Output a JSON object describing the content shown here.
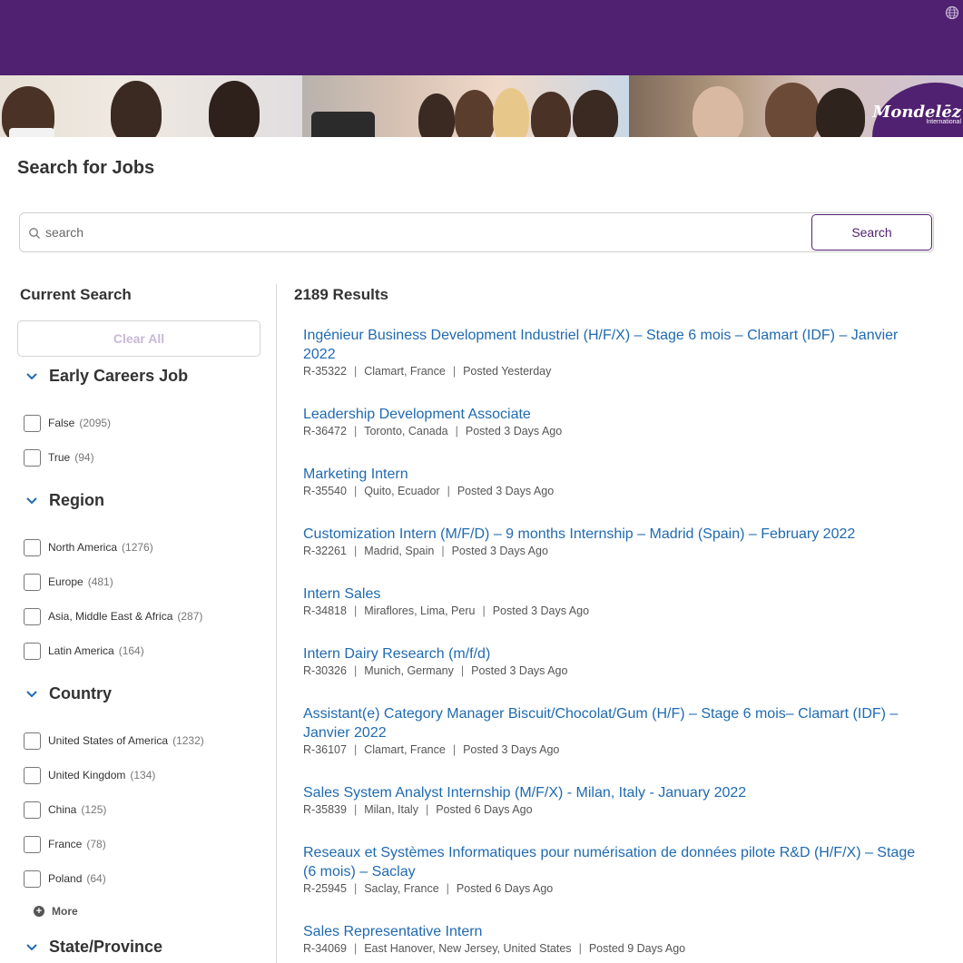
{
  "banner": {
    "brand_name": "Mondelēz",
    "brand_sub": "International"
  },
  "page": {
    "title": "Search for Jobs"
  },
  "search": {
    "placeholder": "search",
    "button_label": "Search"
  },
  "sidebar": {
    "current_search_label": "Current Search",
    "clear_all_label": "Clear All",
    "facets": [
      {
        "title": "Early Careers Job",
        "options": [
          {
            "label": "False",
            "count": "(2095)"
          },
          {
            "label": "True",
            "count": "(94)"
          }
        ]
      },
      {
        "title": "Region",
        "options": [
          {
            "label": "North America",
            "count": "(1276)"
          },
          {
            "label": "Europe",
            "count": "(481)"
          },
          {
            "label": "Asia, Middle East & Africa",
            "count": "(287)"
          },
          {
            "label": "Latin America",
            "count": "(164)"
          }
        ]
      },
      {
        "title": "Country",
        "options": [
          {
            "label": "United States of America",
            "count": "(1232)"
          },
          {
            "label": "United Kingdom",
            "count": "(134)"
          },
          {
            "label": "China",
            "count": "(125)"
          },
          {
            "label": "France",
            "count": "(78)"
          },
          {
            "label": "Poland",
            "count": "(64)"
          }
        ],
        "more_label": "More"
      },
      {
        "title": "State/Province",
        "options": []
      }
    ]
  },
  "results": {
    "count_label": "2189 Results",
    "jobs": [
      {
        "title": "Ingénieur Business Development Industriel (H/F/X) – Stage 6 mois – Clamart (IDF) – Janvier 2022",
        "id": "R-35322",
        "location": "Clamart, France",
        "posted": "Posted Yesterday"
      },
      {
        "title": "Leadership Development Associate",
        "id": "R-36472",
        "location": "Toronto, Canada",
        "posted": "Posted 3 Days Ago"
      },
      {
        "title": "Marketing Intern",
        "id": "R-35540",
        "location": "Quito, Ecuador",
        "posted": "Posted 3 Days Ago"
      },
      {
        "title": "Customization Intern (M/F/D) – 9 months Internship – Madrid (Spain) – February 2022",
        "id": "R-32261",
        "location": "Madrid, Spain",
        "posted": "Posted 3 Days Ago"
      },
      {
        "title": "Intern Sales",
        "id": "R-34818",
        "location": "Miraflores, Lima, Peru",
        "posted": "Posted 3 Days Ago"
      },
      {
        "title": "Intern Dairy Research (m/f/d)",
        "id": "R-30326",
        "location": "Munich, Germany",
        "posted": "Posted 3 Days Ago"
      },
      {
        "title": "Assistant(e) Category Manager Biscuit/Chocolat/Gum (H/F) – Stage 6 mois– Clamart (IDF) – Janvier 2022",
        "id": "R-36107",
        "location": "Clamart, France",
        "posted": "Posted 3 Days Ago"
      },
      {
        "title": "Sales System Analyst Internship (M/F/X) - Milan, Italy - January 2022",
        "id": "R-35839",
        "location": "Milan, Italy",
        "posted": "Posted 6 Days Ago"
      },
      {
        "title": "Reseaux et Systèmes Informatiques pour numérisation de données pilote R&D (H/F/X) – Stage (6 mois) – Saclay",
        "id": "R-25945",
        "location": "Saclay, France",
        "posted": "Posted 6 Days Ago"
      },
      {
        "title": "Sales Representative Intern",
        "id": "R-34069",
        "location": "East Hanover, New Jersey, United States",
        "posted": "Posted 9 Days Ago"
      }
    ]
  }
}
